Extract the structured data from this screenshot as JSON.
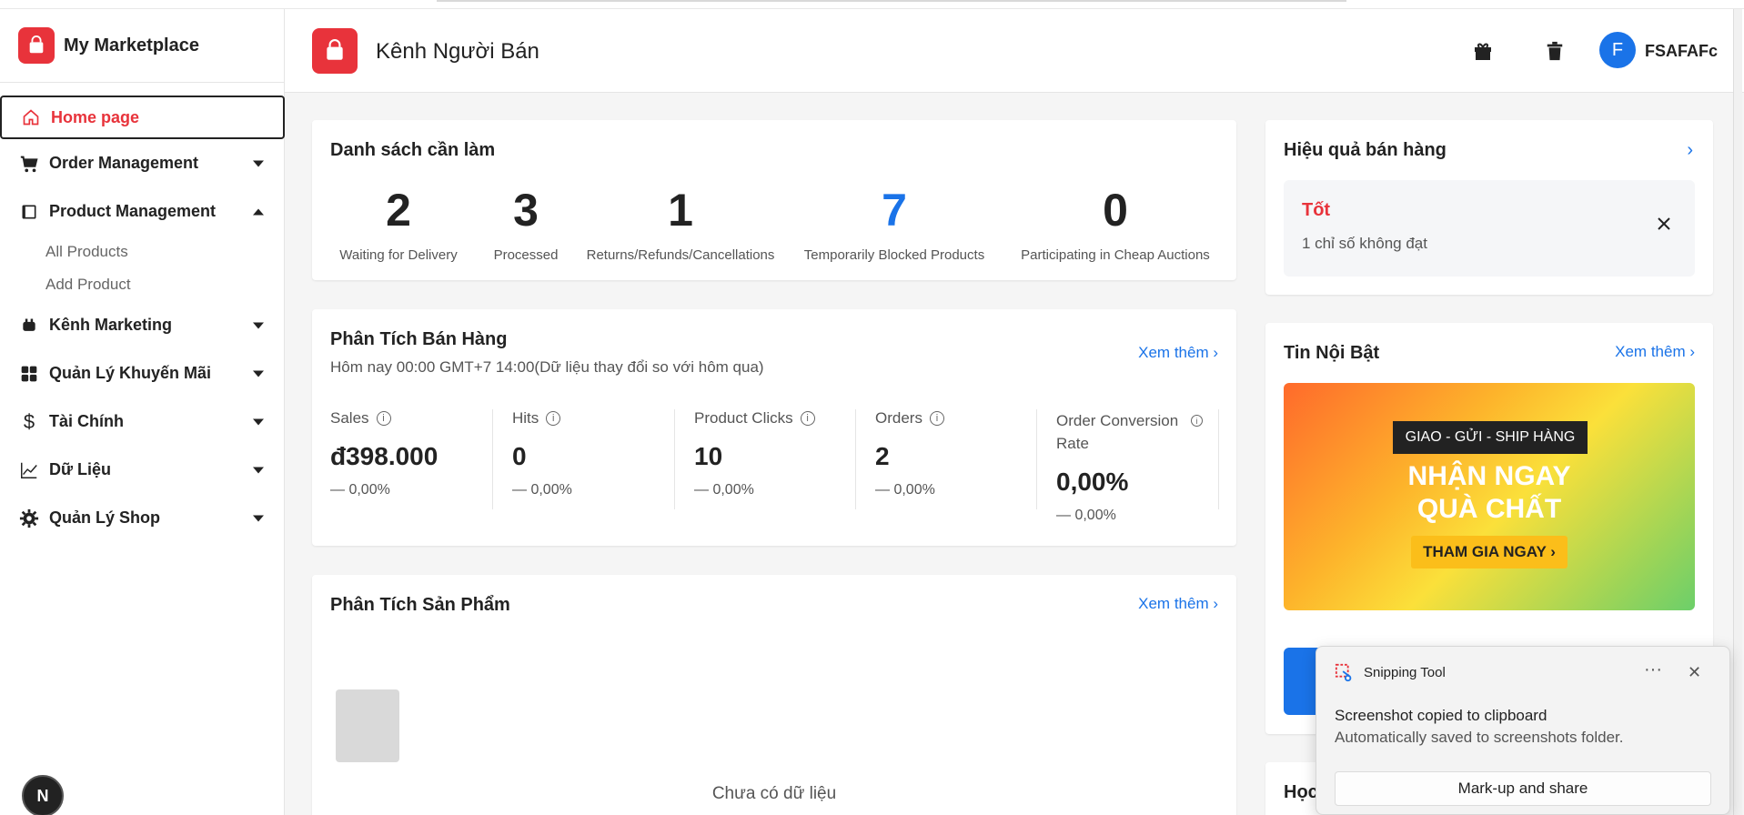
{
  "sidebar": {
    "brand": "My Marketplace",
    "home": "Home page",
    "items": [
      {
        "label": "Order Management"
      },
      {
        "label": "Product Management"
      },
      {
        "label": "Kênh Marketing"
      },
      {
        "label": "Quản Lý Khuyến Mãi"
      },
      {
        "label": "Tài Chính"
      },
      {
        "label": "Dữ Liệu"
      },
      {
        "label": "Quản Lý Shop"
      }
    ],
    "product_sub": [
      "All Products",
      "Add Product"
    ],
    "dev_badge": "N"
  },
  "header": {
    "title": "Kênh Người Bán",
    "avatar_letter": "F",
    "username": "FSAFAFc"
  },
  "todo": {
    "title": "Danh sách cần làm",
    "stats": [
      {
        "value": "2",
        "label": "Waiting for Delivery"
      },
      {
        "value": "3",
        "label": "Processed"
      },
      {
        "value": "1",
        "label": "Returns/Refunds/Cancellations"
      },
      {
        "value": "7",
        "label": "Temporarily Blocked Products"
      },
      {
        "value": "0",
        "label": "Participating in Cheap Auctions"
      }
    ]
  },
  "sales": {
    "title": "Phân Tích Bán Hàng",
    "subtitle": "Hôm nay 00:00 GMT+7 14:00(Dữ liệu thay đổi so với hôm qua)",
    "see_more": "Xem thêm ›",
    "metrics": [
      {
        "label": "Sales",
        "value": "đ398.000",
        "change": "— 0,00%"
      },
      {
        "label": "Hits",
        "value": "0",
        "change": "— 0,00%"
      },
      {
        "label": "Product Clicks",
        "value": "10",
        "change": "— 0,00%"
      },
      {
        "label": "Orders",
        "value": "2",
        "change": "— 0,00%"
      },
      {
        "label": "Order Conversion Rate",
        "value": "0,00%",
        "change": "— 0,00%"
      }
    ]
  },
  "product_analytics": {
    "title": "Phân Tích Sản Phẩm",
    "see_more": "Xem thêm ›",
    "empty": "Chưa có dữ liệu"
  },
  "performance": {
    "title": "Hiệu quả bán hàng",
    "arrow": "›",
    "status": "Tốt",
    "detail": "1 chỉ số không đạt"
  },
  "news": {
    "title": "Tin Nội Bật",
    "see_more": "Xem thêm ›",
    "banner_tag": "GIAO - GỬI - SHIP HÀNG",
    "banner_line1": "NHẬN NGAY",
    "banner_line2": "QUÀ CHẤT",
    "banner_cta": "THAM GIA NGAY ›"
  },
  "learn": {
    "title_partial": "Học"
  },
  "toast": {
    "app": "Snipping Tool",
    "more": "···",
    "close": "✕",
    "message": "Screenshot copied to clipboard",
    "sub": "Automatically saved to screenshots folder.",
    "button": "Mark-up and share"
  },
  "colors": {
    "brand_red": "#e8333b",
    "link_blue": "#1a73e8",
    "highlight_blue": "#1a73e8"
  }
}
